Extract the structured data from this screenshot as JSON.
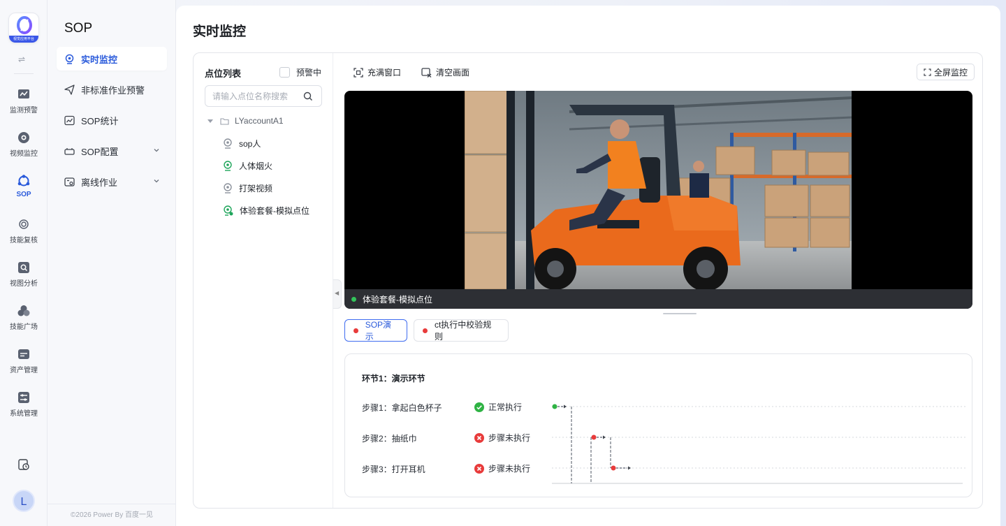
{
  "brand": {
    "logo_caption": "视觉应用平台"
  },
  "rail": {
    "toggle_glyph": "⇌",
    "items": [
      {
        "label": "监测预警"
      },
      {
        "label": "视频监控"
      },
      {
        "label": "SOP"
      },
      {
        "label": "技能复核"
      },
      {
        "label": "视图分析"
      },
      {
        "label": "技能广场"
      },
      {
        "label": "资产管理"
      },
      {
        "label": "系统管理"
      }
    ],
    "avatar_letter": "L"
  },
  "subnav": {
    "title": "SOP",
    "items": [
      {
        "label": "实时监控"
      },
      {
        "label": "非标准作业预警"
      },
      {
        "label": "SOP统计"
      },
      {
        "label": "SOP配置"
      },
      {
        "label": "离线作业"
      }
    ],
    "footer": "©2026 Power By 百度一见"
  },
  "page": {
    "title": "实时监控"
  },
  "point_list": {
    "title": "点位列表",
    "warning_label": "预警中",
    "search_placeholder": "请输入点位名称搜索",
    "root": "LYaccountA1",
    "nodes": [
      {
        "label": "sop人"
      },
      {
        "label": "人体烟火"
      },
      {
        "label": "打架视频"
      },
      {
        "label": "体验套餐-模拟点位"
      }
    ]
  },
  "toolbar": {
    "fill_window": "充满窗口",
    "clear_screen": "清空画面",
    "fullscreen": "全屏监控"
  },
  "video": {
    "caption": "体验套餐-模拟点位",
    "status_color": "#33c45b"
  },
  "tabs": [
    {
      "label": "SOP演示"
    },
    {
      "label": "ct执行中校验规则"
    }
  ],
  "sop": {
    "section_title": "环节1：演示环节",
    "steps": [
      {
        "label": "步骤1：拿起白色杯子",
        "status": "正常执行",
        "status_color": "#2fb344"
      },
      {
        "label": "步骤2：抽纸巾",
        "status": "步骤未执行",
        "status_color": "#e83b3b"
      },
      {
        "label": "步骤3：打开耳机",
        "status": "步骤未执行",
        "status_color": "#e83b3b"
      }
    ]
  }
}
